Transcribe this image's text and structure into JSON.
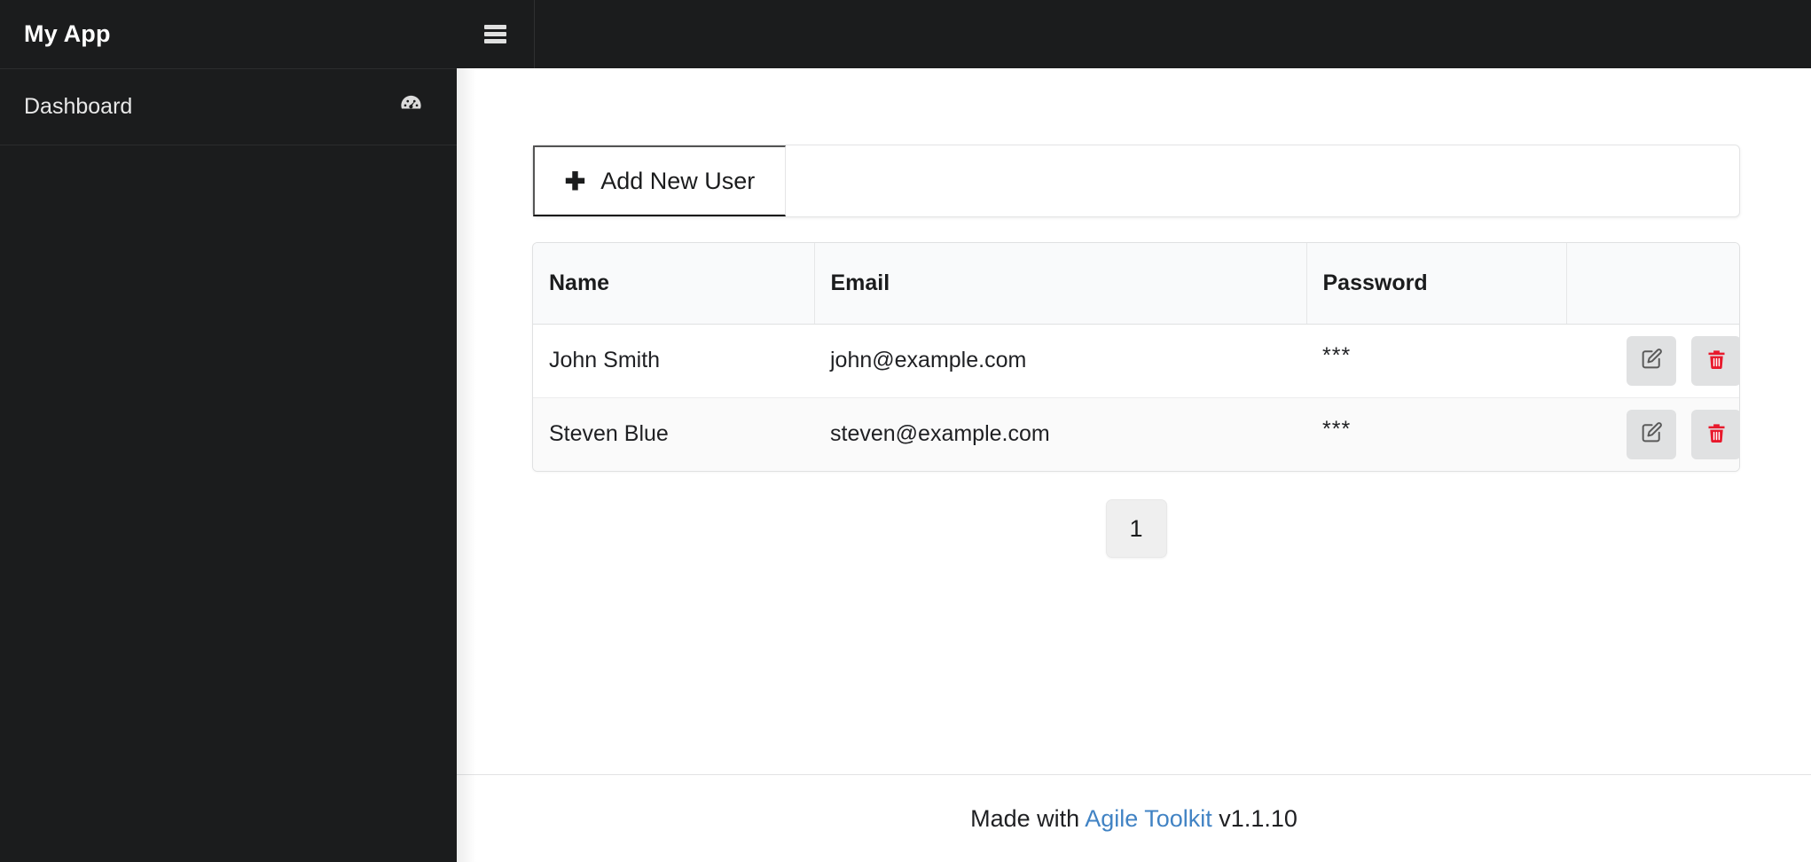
{
  "sidebar": {
    "brand": "My App",
    "items": [
      {
        "label": "Dashboard",
        "icon": "gauge-icon"
      }
    ]
  },
  "topbar": {
    "menu_icon": "hamburger-menu-icon"
  },
  "toolbar": {
    "add_button_label": "Add New User",
    "add_button_icon": "plus-icon"
  },
  "table": {
    "columns": [
      "Name",
      "Email",
      "Password",
      ""
    ],
    "rows": [
      {
        "name": "John Smith",
        "email": "john@example.com",
        "password": "***",
        "edit_icon": "edit-pencil-icon",
        "delete_icon": "trash-icon"
      },
      {
        "name": "Steven Blue",
        "email": "steven@example.com",
        "password": "***",
        "edit_icon": "edit-pencil-icon",
        "delete_icon": "trash-icon"
      }
    ]
  },
  "pagination": {
    "pages": [
      "1"
    ],
    "current": "1"
  },
  "footer": {
    "prefix": "Made with ",
    "link": "Agile Toolkit",
    "suffix": " v1.1.10"
  },
  "colors": {
    "sidebar_bg": "#1b1c1d",
    "link_blue": "#4183c4",
    "delete_red": "#e8192c",
    "header_bg": "#f9fafb"
  }
}
